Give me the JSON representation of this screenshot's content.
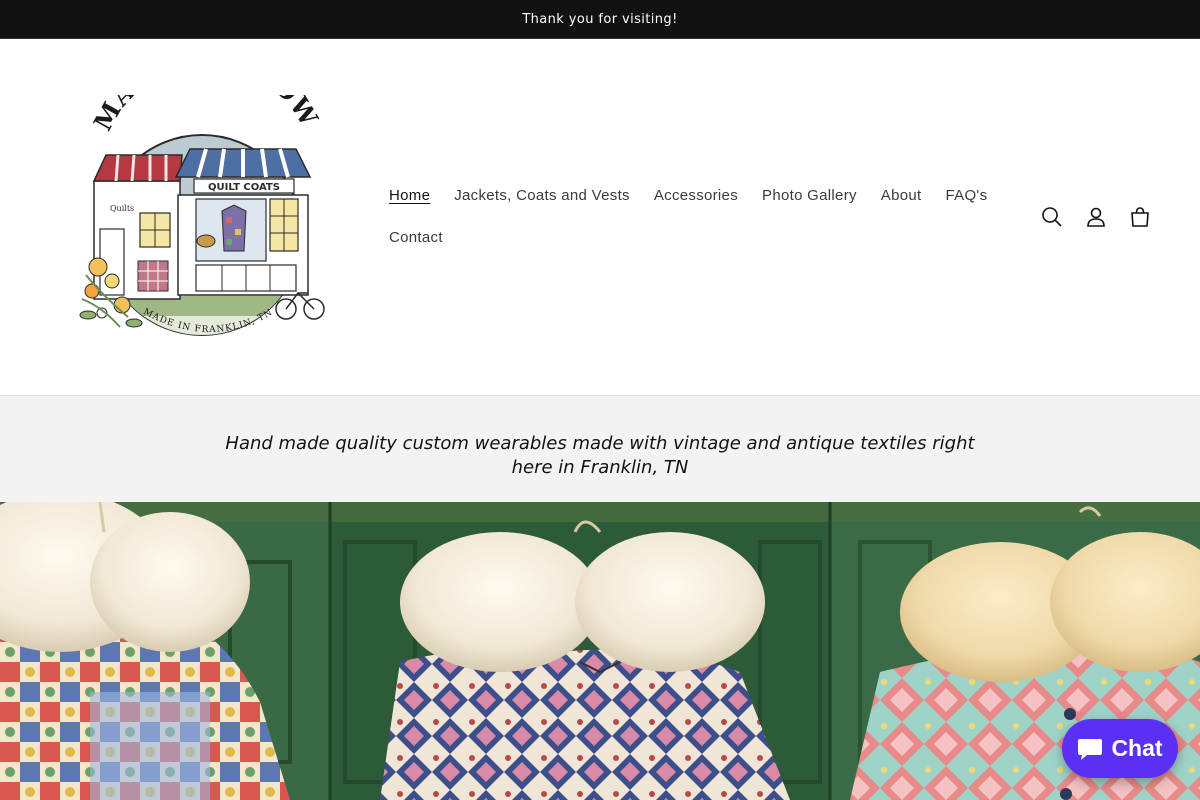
{
  "announcement": {
    "text": "Thank you for visiting!"
  },
  "logo": {
    "brand": "MABEL & SNOW",
    "shop_sign": "QUILT COATS",
    "side_sign": "Quilts",
    "made_in": "MADE IN FRANKLIN, TN"
  },
  "nav": {
    "items": [
      {
        "label": "Home",
        "active": true
      },
      {
        "label": "Jackets, Coats and Vests",
        "active": false
      },
      {
        "label": "Accessories",
        "active": false
      },
      {
        "label": "Photo Gallery",
        "active": false
      },
      {
        "label": "About",
        "active": false
      },
      {
        "label": "FAQ's",
        "active": false
      },
      {
        "label": "Contact",
        "active": false
      }
    ]
  },
  "header_icons": [
    "search-icon",
    "account-icon",
    "cart-icon"
  ],
  "tagline": {
    "text": "Hand made quality custom wearables made with vintage and antique textiles right here in Franklin, TN"
  },
  "chat": {
    "label": "Chat",
    "color": "#5a31f4"
  },
  "colors": {
    "announcement_bg": "#121212",
    "tagline_bg": "#f3f3f3"
  }
}
